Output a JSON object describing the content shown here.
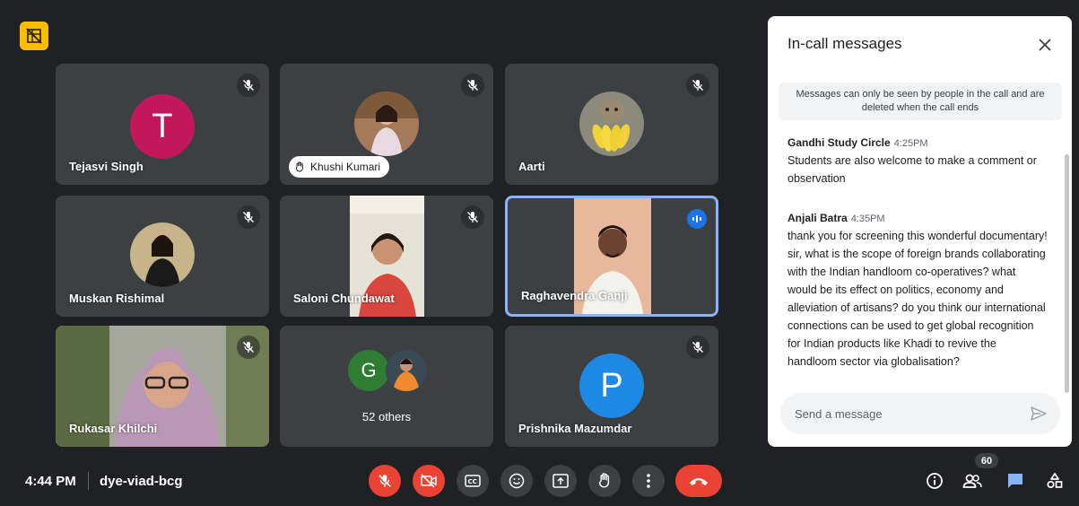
{
  "participants": [
    {
      "name": "Tejasvi Singh",
      "initial": "T"
    },
    {
      "name": "Khushi Kumari"
    },
    {
      "name": "Aarti"
    },
    {
      "name": "Muskan Rishimal"
    },
    {
      "name": "Saloni Chundawat"
    },
    {
      "name": "Raghavendra Ganji"
    },
    {
      "name": "Rukasar Khilchi"
    },
    {
      "others_initial": "G",
      "others_label": "52 others"
    },
    {
      "name": "Prishnika Mazumdar",
      "initial": "P"
    }
  ],
  "chat": {
    "title": "In-call messages",
    "notice": "Messages can only be seen by people in the call and are deleted when the call ends",
    "messages": [
      {
        "sender": "Gandhi Study Circle",
        "time": "4:25PM",
        "text": "Students are also welcome to make a comment or observation"
      },
      {
        "sender": "Anjali Batra",
        "time": "4:35PM",
        "text": "thank you for screening this wonderful documentary! sir, what is the scope of foreign brands collaborating with the Indian handloom co-operatives? what would be its effect on politics, economy and alleviation of artisans? do you think our international connections can be used to get global recognition for Indian products like Khadi to revive the handloom sector via globalisation?"
      }
    ],
    "input_placeholder": "Send a message"
  },
  "bottom_bar": {
    "time": "4:44 PM",
    "meeting_code": "dye-viad-bcg",
    "people_count": "60"
  },
  "colors": {
    "background": "#202124",
    "tile": "#3c4043",
    "danger": "#ea4335",
    "accent": "#8ab4f8",
    "avatar_t": "#c2185b",
    "avatar_p": "#1e88e5",
    "avatar_g": "#2e7d32"
  },
  "icons": [
    "mic-off-icon",
    "hand-raise-icon",
    "speaking-icon",
    "close-icon",
    "send-icon",
    "camera-off-icon",
    "captions-icon",
    "emoji-icon",
    "present-icon",
    "more-icon",
    "hangup-icon",
    "info-icon",
    "people-icon",
    "chat-icon",
    "activities-icon"
  ]
}
